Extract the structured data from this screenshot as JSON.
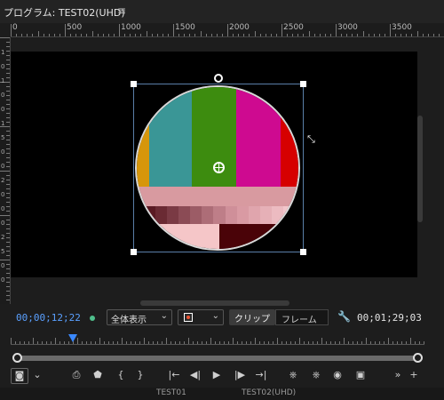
{
  "panel": {
    "title": "プログラム: TEST02(UHD)",
    "menu_icon": "hamburger-menu-icon"
  },
  "ruler_top": {
    "labels": [
      "0",
      "500",
      "1000",
      "1500",
      "2000",
      "2500",
      "3000",
      "3500"
    ]
  },
  "ruler_left": {
    "labels": [
      "1",
      "0",
      "1",
      "0",
      "0",
      "1",
      "5",
      "0",
      "0",
      "2",
      "0",
      "0",
      "0",
      "2",
      "5",
      "0",
      "0"
    ]
  },
  "clip": {
    "top_bars": [
      "#d6960b",
      "#3a9696",
      "#3d8c0f",
      "#ce0a90",
      "#d60000"
    ],
    "middle_band": "#d89aa0",
    "gradient_steps": [
      "#5a1a23",
      "#6a2a33",
      "#7a3a44",
      "#8b4b55",
      "#9c5c66",
      "#ad6d77",
      "#be7e88",
      "#cf8f99",
      "#d99aa3",
      "#e0a5ad",
      "#e6b0b7",
      "#ecbbc1",
      "#f2c6cb"
    ],
    "bottom_left": "#f5c6c8",
    "bottom_right": "#4a0308"
  },
  "controls": {
    "current_timecode": "00;00;12;22",
    "zoom_select": "全体表示",
    "resolution_select_icon": "record-icon",
    "segment_clip": "クリップ",
    "segment_frame": "フレーム",
    "duration_timecode": "00;01;29;03",
    "playhead_fraction": 0.15
  },
  "toolbar": {
    "export_frame_icon": "camera-icon",
    "marker_icon": "marker-icon",
    "in_point": "{",
    "out_point": "}",
    "go_in": "|←",
    "step_back": "◀|",
    "play": "▶",
    "step_forward": "|▶",
    "go_out": "→|",
    "more": "»",
    "add": "+"
  },
  "tabs": [
    "TEST01",
    "TEST02(UHD)"
  ]
}
